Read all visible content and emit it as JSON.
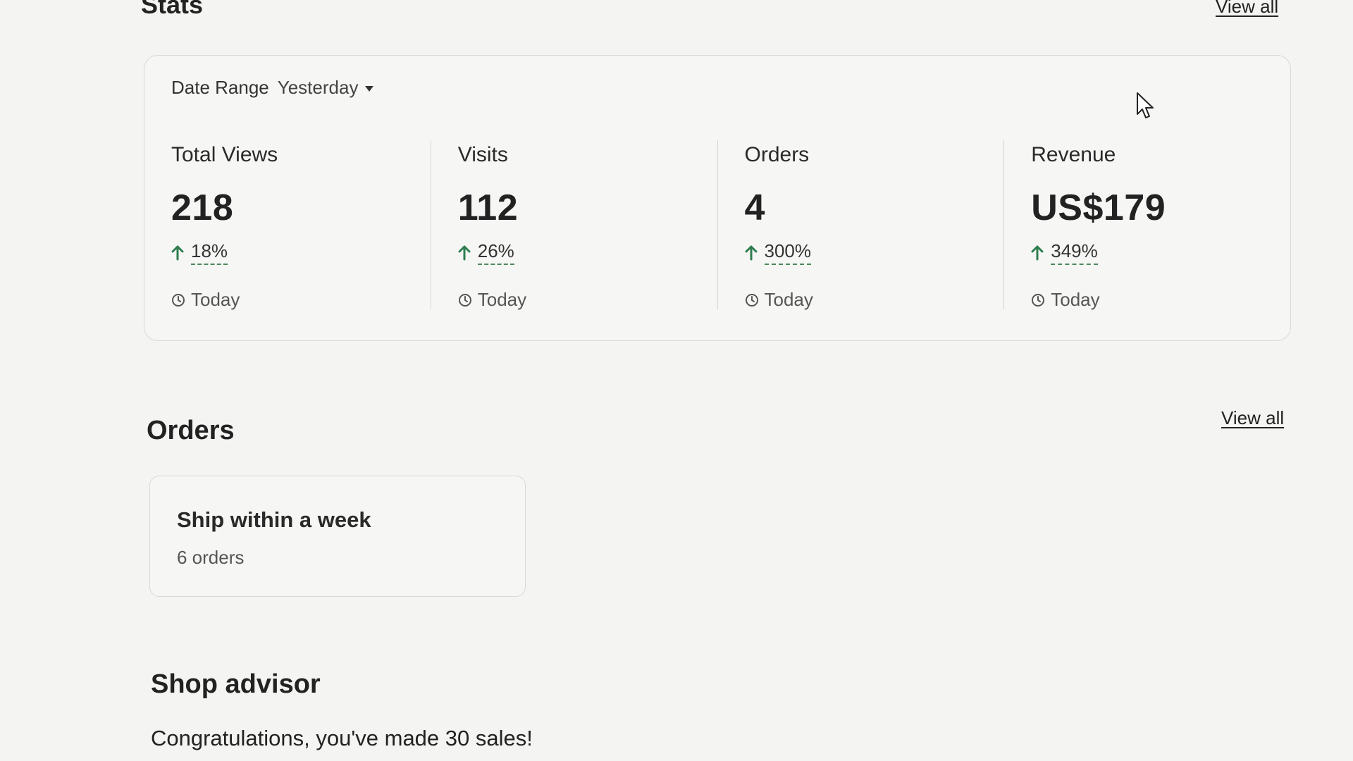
{
  "stats": {
    "title": "Stats",
    "view_all": "View all",
    "date_range": {
      "label": "Date Range",
      "selected": "Yesterday"
    },
    "metrics": [
      {
        "label": "Total Views",
        "value": "218",
        "change": "18%",
        "period": "Today"
      },
      {
        "label": "Visits",
        "value": "112",
        "change": "26%",
        "period": "Today"
      },
      {
        "label": "Orders",
        "value": "4",
        "change": "300%",
        "period": "Today"
      },
      {
        "label": "Revenue",
        "value": "US$179",
        "change": "349%",
        "period": "Today"
      }
    ]
  },
  "orders": {
    "title": "Orders",
    "view_all": "View all",
    "card": {
      "title": "Ship within a week",
      "subtitle": "6 orders"
    }
  },
  "shop_advisor": {
    "title": "Shop advisor",
    "message": "Congratulations, you've made 30 sales!"
  },
  "colors": {
    "trend_up": "#2e7d4f",
    "border": "#d8d8d4",
    "text": "#222222"
  },
  "icons": {
    "trend": "arrow-up-icon",
    "period": "clock-icon",
    "dropdown": "chevron-down-icon"
  }
}
